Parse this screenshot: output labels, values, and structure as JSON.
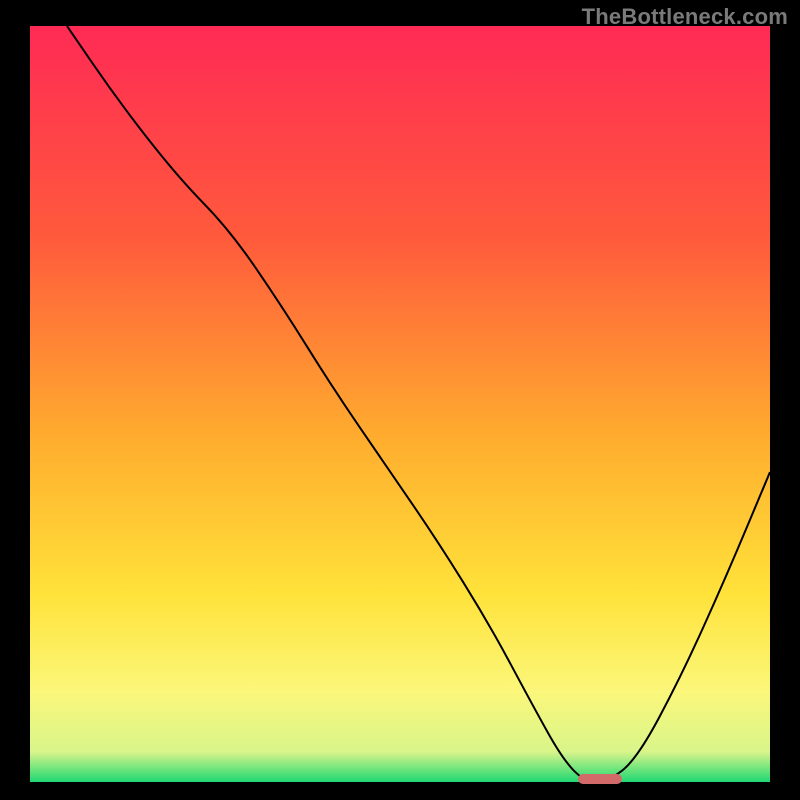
{
  "watermark": "TheBottleneck.com",
  "chart_data": {
    "type": "line",
    "title": "",
    "xlabel": "",
    "ylabel": "",
    "xlim": [
      0,
      100
    ],
    "ylim": [
      0,
      100
    ],
    "grid": false,
    "legend": false,
    "gradient_stops": [
      {
        "pct": 0,
        "color": "#ff2a55"
      },
      {
        "pct": 28,
        "color": "#ff5a3c"
      },
      {
        "pct": 55,
        "color": "#ffae2e"
      },
      {
        "pct": 75,
        "color": "#ffe23a"
      },
      {
        "pct": 88,
        "color": "#fbf77a"
      },
      {
        "pct": 96,
        "color": "#d9f58a"
      },
      {
        "pct": 100,
        "color": "#1fd873"
      }
    ],
    "series": [
      {
        "name": "bottleneck-curve",
        "color": "#000000",
        "width": 2,
        "x": [
          5,
          12,
          20,
          27,
          34,
          41,
          48,
          55,
          62,
          68,
          72,
          75,
          78,
          82,
          88,
          94,
          100
        ],
        "y": [
          100,
          90,
          80,
          73,
          63,
          52,
          42,
          32,
          21,
          10,
          3,
          0,
          0,
          3,
          14,
          27,
          41
        ]
      }
    ],
    "marker": {
      "name": "optimal-range",
      "x_start": 74,
      "x_end": 80,
      "y": 0,
      "color": "#d26a6a"
    }
  }
}
